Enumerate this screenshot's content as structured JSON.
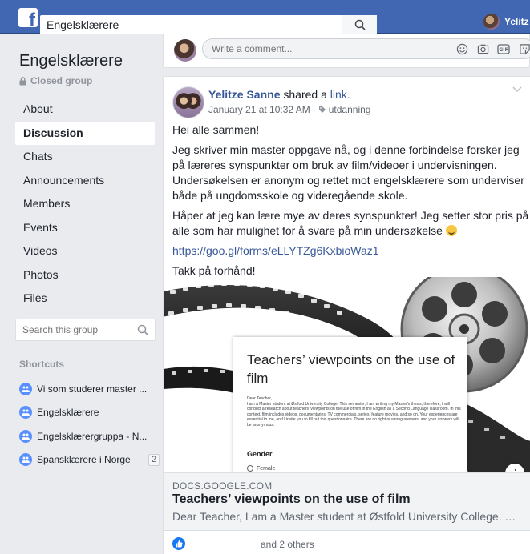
{
  "topbar": {
    "logo": "f",
    "search_value": "Engelsklærere",
    "user_name": "Yelitz"
  },
  "sidebar": {
    "group_name": "Engelsklærere",
    "privacy": "Closed group",
    "nav": [
      {
        "label": "About",
        "active": false
      },
      {
        "label": "Discussion",
        "active": true
      },
      {
        "label": "Chats",
        "active": false
      },
      {
        "label": "Announcements",
        "active": false
      },
      {
        "label": "Members",
        "active": false
      },
      {
        "label": "Events",
        "active": false
      },
      {
        "label": "Videos",
        "active": false
      },
      {
        "label": "Photos",
        "active": false
      },
      {
        "label": "Files",
        "active": false
      }
    ],
    "search_placeholder": "Search this group",
    "shortcuts_title": "Shortcuts",
    "shortcuts": [
      {
        "label": "Vi som studerer master ...",
        "badge": ""
      },
      {
        "label": "Engelsklærere",
        "badge": ""
      },
      {
        "label": "Engelsklærergruppa - N...",
        "badge": ""
      },
      {
        "label": "Spansklærere i Norge",
        "badge": "2"
      }
    ]
  },
  "comment_box": {
    "placeholder": "Write a comment...",
    "icons": [
      "emoji-icon",
      "camera-icon",
      "gif-icon",
      "sticker-icon"
    ]
  },
  "post": {
    "author": "Yelitze Sanne",
    "action": "shared a",
    "object": "link.",
    "timestamp": "January 21 at 10:32 AM",
    "separator": "·",
    "tag": "utdanning",
    "paragraphs": [
      "Hei alle sammen!",
      "Jeg skriver min master oppgave nå, og i denne forbindelse forsker jeg på læreres synspunkter om bruk av film/videoer i undervisningen. Undersøkelsen er anonym og rettet mot engelsklærere som underviser både på ungdomsskole og videregående skole.",
      "Håper at jeg kan lære mye av deres synspunkter! Jeg setter stor pris på alle som har mulighet for å svare på min undersøkelse"
    ],
    "link_url": "https://goo.gl/forms/eLLYTZg6KxbioWaz1",
    "closing": "Takk på forhånd!",
    "preview": {
      "doc_title": "Teachers’ viewpoints on the use of film",
      "doc_intro_greeting": "Dear Teacher,",
      "doc_intro": "I am a Master student at Østfold University College. This semester, I am writing my Master's thesis; therefore, I will conduct a research about teachers' viewpoints on the use of film in the English as a Second Language classroom. In this context, film includes videos, documentaries, TV commercials, series, feature movies, and so on. Your experiences are essential to me, and I invite you to fill out this questionnaire. There are no right or wrong answers, and your answers will be anonymous.",
      "doc_question": "Gender",
      "doc_option": "Female",
      "info": "i"
    },
    "link_domain": "DOCS.GOOGLE.COM",
    "link_title": "Teachers’ viewpoints on the use of film",
    "link_desc": "Dear Teacher, I am a Master student at Østfold University College. This…",
    "reactions_text": "and 2 others"
  },
  "colors": {
    "topbar": "#4267b2",
    "link": "#385898",
    "like": "#1877f2",
    "shortcut_icon": "#5890ff"
  }
}
